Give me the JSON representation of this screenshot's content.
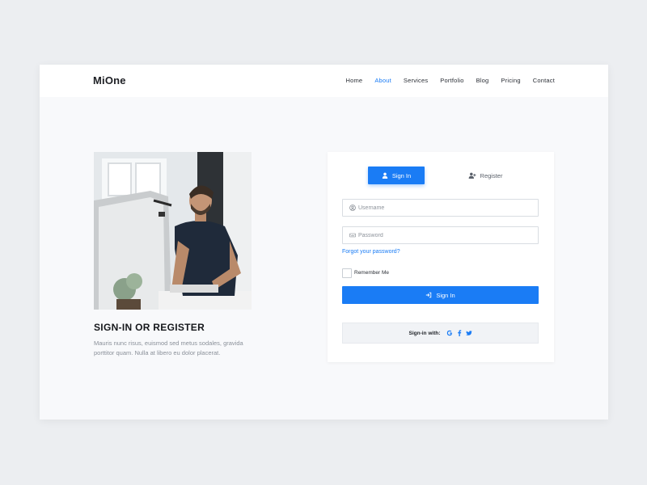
{
  "brand": {
    "logo": "MiOne"
  },
  "nav": {
    "items": [
      {
        "label": "Home",
        "active": false
      },
      {
        "label": "About",
        "active": true
      },
      {
        "label": "Services",
        "active": false
      },
      {
        "label": "Portfolio",
        "active": false
      },
      {
        "label": "Blog",
        "active": false
      },
      {
        "label": "Pricing",
        "active": false
      },
      {
        "label": "Contact",
        "active": false
      }
    ]
  },
  "intro": {
    "heading": "SIGN-IN OR REGISTER",
    "text": "Mauris nunc risus, euismod sed metus sodales, gravida porttitor quam. Nulla at libero eu dolor placerat."
  },
  "form": {
    "tabs": {
      "signin": "Sign In",
      "register": "Register"
    },
    "username_placeholder": "Username",
    "password_placeholder": "Password",
    "forgot": "Forgot your password?",
    "remember": "Remember Me",
    "submit": "Sign In",
    "social_label": "Sign-in with:",
    "social_icons": [
      "google-icon",
      "facebook-icon",
      "twitter-icon"
    ]
  },
  "colors": {
    "accent": "#1a7cf5",
    "page_bg": "#eceef1",
    "section_bg": "#f8f9fb"
  }
}
